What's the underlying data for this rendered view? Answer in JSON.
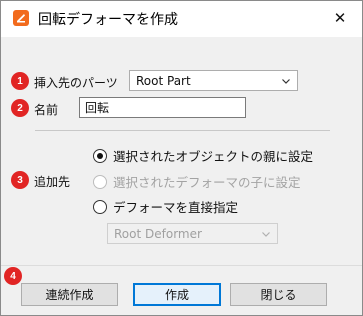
{
  "window": {
    "title": "回転デフォーマを作成",
    "close_glyph": "✕"
  },
  "badges": [
    "1",
    "2",
    "3",
    "4"
  ],
  "insert_target": {
    "label": "挿入先のパーツ",
    "value": "Root Part"
  },
  "name": {
    "label": "名前",
    "value": "回転"
  },
  "add_to": {
    "label": "追加先",
    "options": [
      {
        "label": "選択されたオブジェクトの親に設定",
        "checked": true,
        "disabled": false
      },
      {
        "label": "選択されたデフォーマの子に設定",
        "checked": false,
        "disabled": true
      },
      {
        "label": "デフォーマを直接指定",
        "checked": false,
        "disabled": false
      }
    ],
    "deformer_select": {
      "value": "Root Deformer",
      "disabled": true
    }
  },
  "buttons": {
    "continuous": "連続作成",
    "create": "作成",
    "close": "閉じる"
  },
  "colors": {
    "badge": "#e12524",
    "app_icon": "#f26b1d",
    "focus": "#0078d7"
  }
}
